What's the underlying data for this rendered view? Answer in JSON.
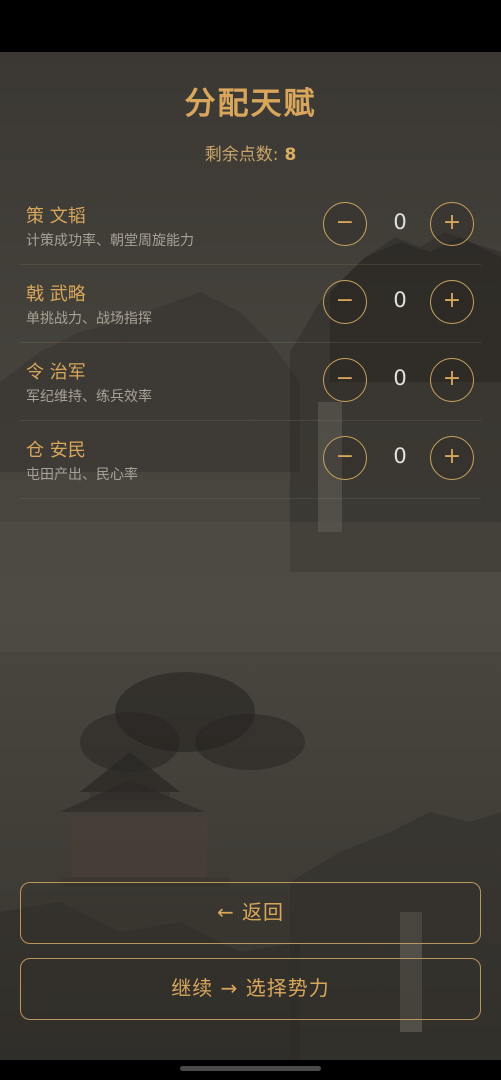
{
  "screen": {
    "title": "分配天赋",
    "points_label": "剩余点数:",
    "points_value": "8"
  },
  "talents": [
    {
      "name": "策 文韬",
      "desc": "计策成功率、朝堂周旋能力",
      "value": "0",
      "minus": "−",
      "plus": "+"
    },
    {
      "name": "戟 武略",
      "desc": "单挑战力、战场指挥",
      "value": "0",
      "minus": "−",
      "plus": "+"
    },
    {
      "name": "令 治军",
      "desc": "军纪维持、练兵效率",
      "value": "0",
      "minus": "−",
      "plus": "+"
    },
    {
      "name": "仓 安民",
      "desc": "屯田产出、民心率",
      "value": "0",
      "minus": "−",
      "plus": "+"
    }
  ],
  "actions": {
    "back_label": "← 返回",
    "continue_label": "继续 → 选择势力"
  },
  "colors": {
    "accent": "#d8a75c",
    "background": "#45423c",
    "text_value": "#e4e1dc",
    "text_muted": "#a8a196"
  }
}
